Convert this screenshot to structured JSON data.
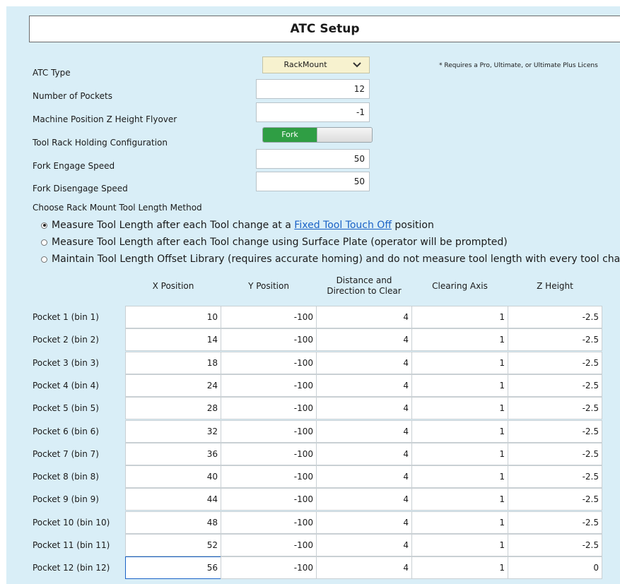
{
  "title": "ATC Setup",
  "settings": {
    "atc_type_label": "ATC Type",
    "atc_type_value": "RackMount",
    "note": "* Requires a Pro, Ultimate, or Ultimate Plus Licens",
    "pockets_label": "Number of Pockets",
    "pockets_value": "12",
    "flyover_label": "Machine Position Z Height Flyover",
    "flyover_value": "-1",
    "holding_label": "Tool Rack Holding Configuration",
    "holding_value": "Fork",
    "engage_label": "Fork Engage Speed",
    "engage_value": "50",
    "disengage_label": "Fork Disengage Speed",
    "disengage_value": "50"
  },
  "method": {
    "label": "Choose Rack Mount Tool Length Method",
    "options": [
      {
        "pre": "Measure Tool Length after each Tool change at a ",
        "link": "Fixed Tool Touch Off",
        "post": " position",
        "checked": true
      },
      {
        "pre": "Measure Tool Length after each Tool change using Surface Plate (operator will be prompted)",
        "link": "",
        "post": "",
        "checked": false
      },
      {
        "pre": "Maintain Tool Length Offset Library (requires accurate homing) and do not measure tool length with every tool change",
        "link": "",
        "post": "",
        "checked": false
      }
    ]
  },
  "table": {
    "columns": [
      "X Position",
      "Y Position",
      "Distance and\nDirection to Clear",
      "Clearing Axis",
      "Z Height"
    ],
    "rows": [
      {
        "label": "Pocket 1 (bin 1)",
        "values": [
          "10",
          "-100",
          "4",
          "1",
          "-2.5"
        ]
      },
      {
        "label": "Pocket 2 (bin 2)",
        "values": [
          "14",
          "-100",
          "4",
          "1",
          "-2.5"
        ]
      },
      {
        "label": "Pocket 3 (bin 3)",
        "values": [
          "18",
          "-100",
          "4",
          "1",
          "-2.5"
        ]
      },
      {
        "label": "Pocket 4 (bin 4)",
        "values": [
          "24",
          "-100",
          "4",
          "1",
          "-2.5"
        ]
      },
      {
        "label": "Pocket 5 (bin 5)",
        "values": [
          "28",
          "-100",
          "4",
          "1",
          "-2.5"
        ]
      },
      {
        "label": "Pocket 6 (bin 6)",
        "values": [
          "32",
          "-100",
          "4",
          "1",
          "-2.5"
        ]
      },
      {
        "label": "Pocket 7 (bin 7)",
        "values": [
          "36",
          "-100",
          "4",
          "1",
          "-2.5"
        ]
      },
      {
        "label": "Pocket 8 (bin 8)",
        "values": [
          "40",
          "-100",
          "4",
          "1",
          "-2.5"
        ]
      },
      {
        "label": "Pocket 9 (bin 9)",
        "values": [
          "44",
          "-100",
          "4",
          "1",
          "-2.5"
        ]
      },
      {
        "label": "Pocket 10 (bin 10)",
        "values": [
          "48",
          "-100",
          "4",
          "1",
          "-2.5"
        ]
      },
      {
        "label": "Pocket 11 (bin 11)",
        "values": [
          "52",
          "-100",
          "4",
          "1",
          "-2.5"
        ]
      },
      {
        "label": "Pocket 12 (bin 12)",
        "values": [
          "56",
          "-100",
          "4",
          "1",
          "0"
        ]
      }
    ]
  },
  "colors": {
    "panel_bg": "#d9eef7",
    "select_bg": "#f7f2cf",
    "toggle_on": "#2f9e44",
    "link": "#1a62c6"
  },
  "icons": {
    "dropdown": "chevron-down-icon"
  }
}
